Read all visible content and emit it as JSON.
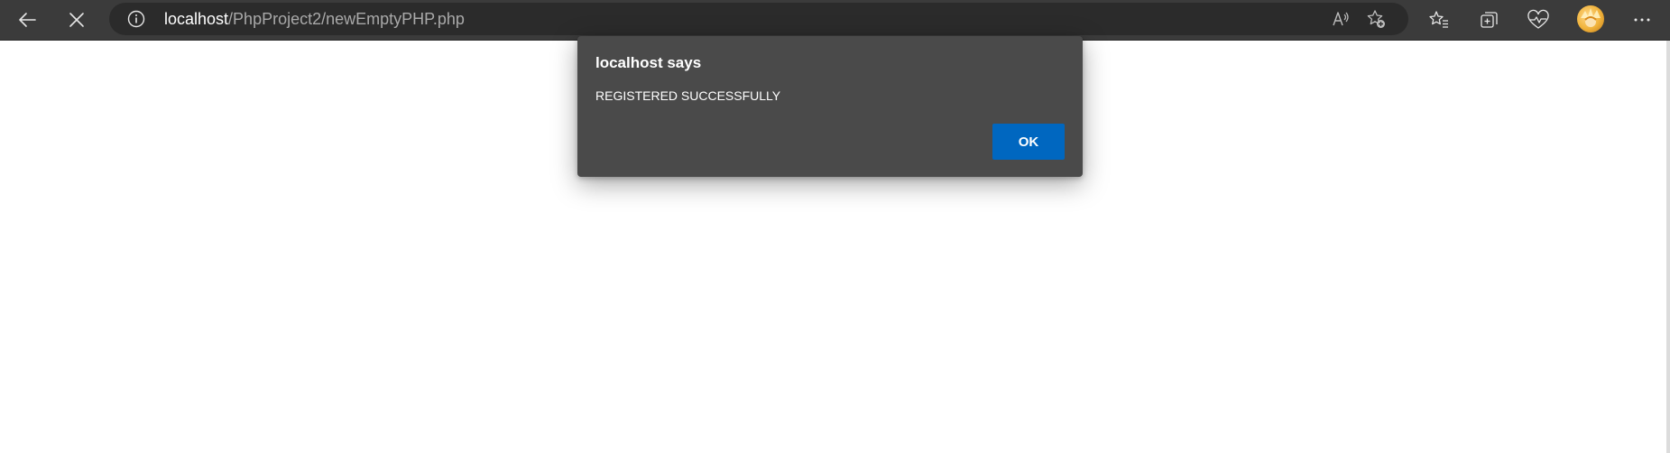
{
  "browser": {
    "back_icon": "arrow-left-icon",
    "stop_icon": "close-icon",
    "address": {
      "info_icon": "info-icon",
      "host": "localhost",
      "path": "/PhpProject2/newEmptyPHP.php",
      "read_aloud_icon": "read-aloud-icon",
      "add_favorite_icon": "star-add-icon"
    },
    "toolbar_icons": [
      "favorites-icon",
      "collections-icon",
      "health-heart-icon",
      "profile-avatar",
      "more-icon"
    ]
  },
  "dialog": {
    "title": "localhost says",
    "message": "REGISTERED SUCCESSFULLY",
    "ok_label": "OK",
    "ok_color": "#0067c0",
    "background": "#4a4a4a"
  }
}
